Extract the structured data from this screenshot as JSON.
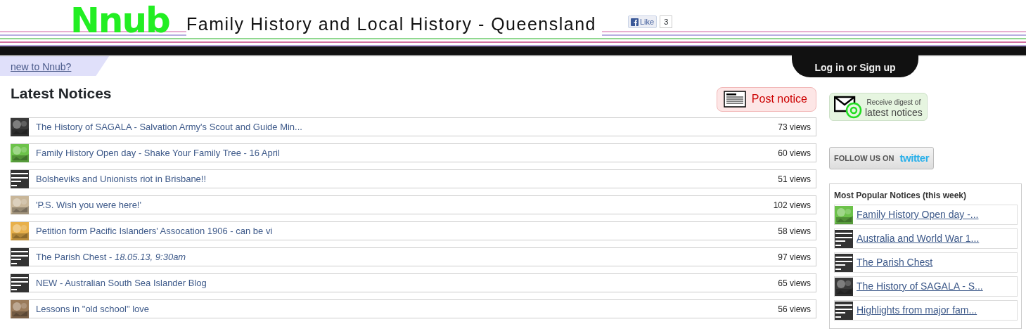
{
  "header": {
    "logo": "Nnub",
    "title": "Family History and Local History - Queensland",
    "like": {
      "label": "Like",
      "count": "3"
    }
  },
  "nav": {
    "new_tab": "new to Nnub?",
    "login": "Log in or Sign up"
  },
  "notices": {
    "heading": "Latest Notices",
    "post_button": "Post notice",
    "items": [
      {
        "title": "The History of SAGALA - Salvation Army's Scout and Guide Min...",
        "views": "73 views",
        "kind": "picture",
        "color": "#3a3a3a"
      },
      {
        "title": "Family History Open day - Shake Your Family Tree - 16 April",
        "views": "60 views",
        "kind": "picture",
        "color": "#6cc24a"
      },
      {
        "title": "Bolsheviks and Unionists riot in Brisbane!!",
        "views": "51 views",
        "kind": "document"
      },
      {
        "title": "'P.S. Wish you were here!'",
        "views": "102 views",
        "kind": "picture",
        "color": "#c9b79a"
      },
      {
        "title": "Petition form Pacific Islanders' Assocation 1906 - can be vi",
        "views": "58 views",
        "kind": "picture",
        "color": "#e8b04a"
      },
      {
        "title": "The Parish Chest - *18.05.13, 9:30am*",
        "views": "97 views",
        "kind": "document"
      },
      {
        "title": "NEW - Australian South Sea Islander Blog",
        "views": "65 views",
        "kind": "document"
      },
      {
        "title": "Lessons in \"old school\" love",
        "views": "56 views",
        "kind": "picture",
        "color": "#9a7a5a"
      }
    ]
  },
  "sidebar": {
    "digest": {
      "line1": "Receive digest of",
      "line2": "latest notices"
    },
    "follow": {
      "label": "FOLLOW US ON",
      "brand": "twitter"
    },
    "popular": {
      "heading": "Most Popular Notices (this week)",
      "items": [
        {
          "title": "Family History Open day -...",
          "kind": "picture",
          "color": "#6cc24a"
        },
        {
          "title": "Australia and World War 1...",
          "kind": "document"
        },
        {
          "title": "The Parish Chest",
          "kind": "document"
        },
        {
          "title": "The History of SAGALA - S...",
          "kind": "picture",
          "color": "#3a3a3a"
        },
        {
          "title": "Highlights from major fam...",
          "kind": "document"
        }
      ]
    }
  }
}
